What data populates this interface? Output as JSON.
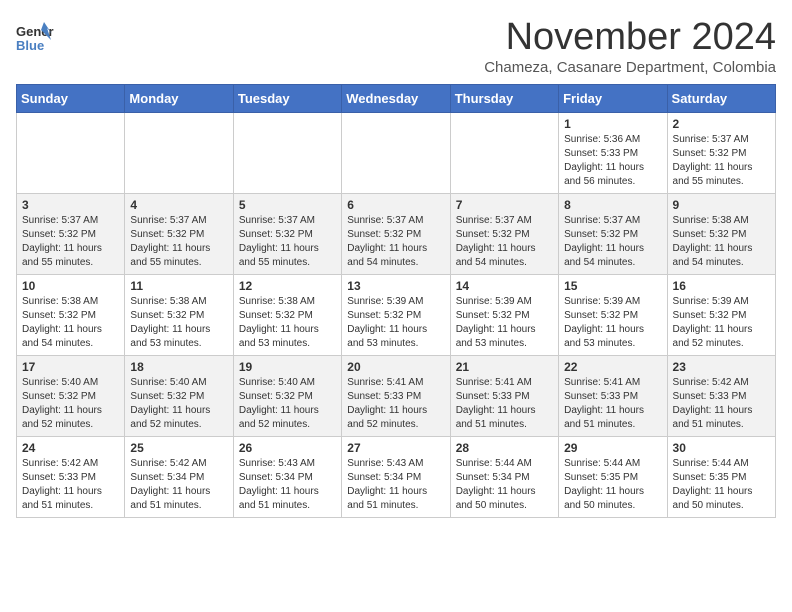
{
  "header": {
    "logo_line1": "General",
    "logo_line2": "Blue",
    "month_title": "November 2024",
    "subtitle": "Chameza, Casanare Department, Colombia"
  },
  "weekdays": [
    "Sunday",
    "Monday",
    "Tuesday",
    "Wednesday",
    "Thursday",
    "Friday",
    "Saturday"
  ],
  "weeks": [
    [
      {
        "day": "",
        "info": ""
      },
      {
        "day": "",
        "info": ""
      },
      {
        "day": "",
        "info": ""
      },
      {
        "day": "",
        "info": ""
      },
      {
        "day": "",
        "info": ""
      },
      {
        "day": "1",
        "info": "Sunrise: 5:36 AM\nSunset: 5:33 PM\nDaylight: 11 hours and 56 minutes."
      },
      {
        "day": "2",
        "info": "Sunrise: 5:37 AM\nSunset: 5:32 PM\nDaylight: 11 hours and 55 minutes."
      }
    ],
    [
      {
        "day": "3",
        "info": "Sunrise: 5:37 AM\nSunset: 5:32 PM\nDaylight: 11 hours and 55 minutes."
      },
      {
        "day": "4",
        "info": "Sunrise: 5:37 AM\nSunset: 5:32 PM\nDaylight: 11 hours and 55 minutes."
      },
      {
        "day": "5",
        "info": "Sunrise: 5:37 AM\nSunset: 5:32 PM\nDaylight: 11 hours and 55 minutes."
      },
      {
        "day": "6",
        "info": "Sunrise: 5:37 AM\nSunset: 5:32 PM\nDaylight: 11 hours and 54 minutes."
      },
      {
        "day": "7",
        "info": "Sunrise: 5:37 AM\nSunset: 5:32 PM\nDaylight: 11 hours and 54 minutes."
      },
      {
        "day": "8",
        "info": "Sunrise: 5:37 AM\nSunset: 5:32 PM\nDaylight: 11 hours and 54 minutes."
      },
      {
        "day": "9",
        "info": "Sunrise: 5:38 AM\nSunset: 5:32 PM\nDaylight: 11 hours and 54 minutes."
      }
    ],
    [
      {
        "day": "10",
        "info": "Sunrise: 5:38 AM\nSunset: 5:32 PM\nDaylight: 11 hours and 54 minutes."
      },
      {
        "day": "11",
        "info": "Sunrise: 5:38 AM\nSunset: 5:32 PM\nDaylight: 11 hours and 53 minutes."
      },
      {
        "day": "12",
        "info": "Sunrise: 5:38 AM\nSunset: 5:32 PM\nDaylight: 11 hours and 53 minutes."
      },
      {
        "day": "13",
        "info": "Sunrise: 5:39 AM\nSunset: 5:32 PM\nDaylight: 11 hours and 53 minutes."
      },
      {
        "day": "14",
        "info": "Sunrise: 5:39 AM\nSunset: 5:32 PM\nDaylight: 11 hours and 53 minutes."
      },
      {
        "day": "15",
        "info": "Sunrise: 5:39 AM\nSunset: 5:32 PM\nDaylight: 11 hours and 53 minutes."
      },
      {
        "day": "16",
        "info": "Sunrise: 5:39 AM\nSunset: 5:32 PM\nDaylight: 11 hours and 52 minutes."
      }
    ],
    [
      {
        "day": "17",
        "info": "Sunrise: 5:40 AM\nSunset: 5:32 PM\nDaylight: 11 hours and 52 minutes."
      },
      {
        "day": "18",
        "info": "Sunrise: 5:40 AM\nSunset: 5:32 PM\nDaylight: 11 hours and 52 minutes."
      },
      {
        "day": "19",
        "info": "Sunrise: 5:40 AM\nSunset: 5:32 PM\nDaylight: 11 hours and 52 minutes."
      },
      {
        "day": "20",
        "info": "Sunrise: 5:41 AM\nSunset: 5:33 PM\nDaylight: 11 hours and 52 minutes."
      },
      {
        "day": "21",
        "info": "Sunrise: 5:41 AM\nSunset: 5:33 PM\nDaylight: 11 hours and 51 minutes."
      },
      {
        "day": "22",
        "info": "Sunrise: 5:41 AM\nSunset: 5:33 PM\nDaylight: 11 hours and 51 minutes."
      },
      {
        "day": "23",
        "info": "Sunrise: 5:42 AM\nSunset: 5:33 PM\nDaylight: 11 hours and 51 minutes."
      }
    ],
    [
      {
        "day": "24",
        "info": "Sunrise: 5:42 AM\nSunset: 5:33 PM\nDaylight: 11 hours and 51 minutes."
      },
      {
        "day": "25",
        "info": "Sunrise: 5:42 AM\nSunset: 5:34 PM\nDaylight: 11 hours and 51 minutes."
      },
      {
        "day": "26",
        "info": "Sunrise: 5:43 AM\nSunset: 5:34 PM\nDaylight: 11 hours and 51 minutes."
      },
      {
        "day": "27",
        "info": "Sunrise: 5:43 AM\nSunset: 5:34 PM\nDaylight: 11 hours and 51 minutes."
      },
      {
        "day": "28",
        "info": "Sunrise: 5:44 AM\nSunset: 5:34 PM\nDaylight: 11 hours and 50 minutes."
      },
      {
        "day": "29",
        "info": "Sunrise: 5:44 AM\nSunset: 5:35 PM\nDaylight: 11 hours and 50 minutes."
      },
      {
        "day": "30",
        "info": "Sunrise: 5:44 AM\nSunset: 5:35 PM\nDaylight: 11 hours and 50 minutes."
      }
    ]
  ]
}
